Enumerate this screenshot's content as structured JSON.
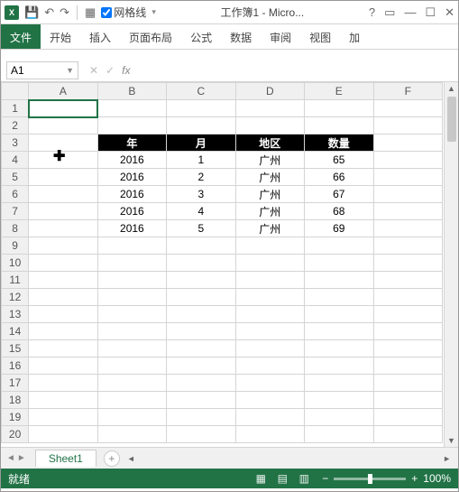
{
  "titlebar": {
    "gridlines_label": "网格线",
    "title": "工作簿1 - Micro...",
    "help": "?"
  },
  "ribbon": {
    "file": "文件",
    "home": "开始",
    "insert": "插入",
    "layout": "页面布局",
    "formula": "公式",
    "data": "数据",
    "review": "审阅",
    "view": "视图",
    "add": "加"
  },
  "namebox": "A1",
  "fx_label": "fx",
  "columns": [
    "A",
    "B",
    "C",
    "D",
    "E",
    "F"
  ],
  "rows": [
    "1",
    "2",
    "3",
    "4",
    "5",
    "6",
    "7",
    "8",
    "9",
    "10",
    "11",
    "12",
    "13",
    "14",
    "15",
    "16",
    "17",
    "18",
    "19",
    "20"
  ],
  "headers": {
    "b": "年",
    "c": "月",
    "d": "地区",
    "e": "数量"
  },
  "dataRows": [
    {
      "b": "2016",
      "c": "1",
      "d": "广州",
      "e": "65"
    },
    {
      "b": "2016",
      "c": "2",
      "d": "广州",
      "e": "66"
    },
    {
      "b": "2016",
      "c": "3",
      "d": "广州",
      "e": "67"
    },
    {
      "b": "2016",
      "c": "4",
      "d": "广州",
      "e": "68"
    },
    {
      "b": "2016",
      "c": "5",
      "d": "广州",
      "e": "69"
    }
  ],
  "sheettab": "Sheet1",
  "status": {
    "ready": "就绪",
    "zoom": "100%"
  },
  "colors": {
    "brand": "#217346"
  }
}
